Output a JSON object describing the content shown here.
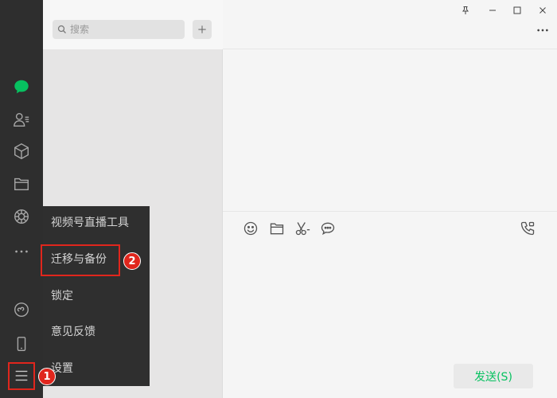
{
  "search": {
    "placeholder": "搜索"
  },
  "menu": {
    "items": [
      {
        "label": "视频号直播工具"
      },
      {
        "label": "迁移与备份"
      },
      {
        "label": "锁定"
      },
      {
        "label": "意见反馈"
      },
      {
        "label": "设置"
      }
    ]
  },
  "annotations": {
    "step1": "1",
    "step2": "2"
  },
  "chat": {
    "send_label": "发送(S)"
  },
  "colors": {
    "accent": "#07c160",
    "highlight": "#e0261d",
    "nav_bg": "#2e2e2e"
  }
}
